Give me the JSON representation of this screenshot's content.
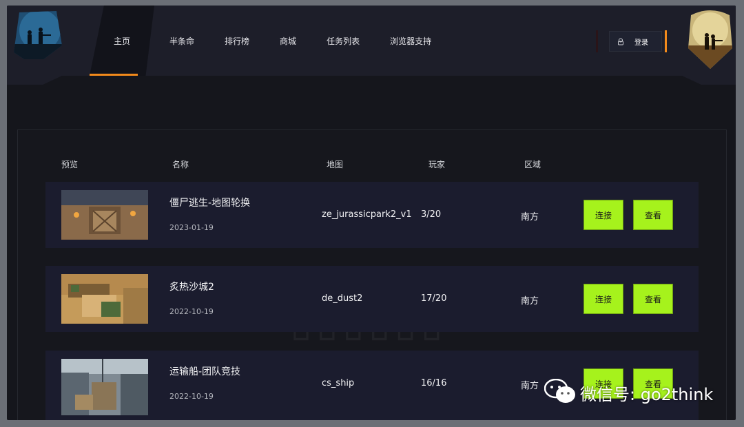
{
  "nav": {
    "items": [
      {
        "label": "主页",
        "active": true
      },
      {
        "label": "半条命",
        "active": false
      },
      {
        "label": "排行榜",
        "active": false
      },
      {
        "label": "商城",
        "active": false
      },
      {
        "label": "任务列表",
        "active": false
      },
      {
        "label": "浏览器支持",
        "active": false
      }
    ],
    "login_label": "登录",
    "login_icon": "user-icon"
  },
  "colors": {
    "accent_orange": "#f28a1b",
    "button_green": "#a6f21c",
    "row_bg": "#1b1c2e",
    "page_bg": "#15161c"
  },
  "table": {
    "headers": {
      "preview": "预览",
      "name": "名称",
      "map": "地图",
      "players": "玩家",
      "region": "区域"
    },
    "rows": [
      {
        "name": "僵尸逃生-地图轮换",
        "date": "2023-01-19",
        "map": "ze_jurassicpark2_v1",
        "players": "3/20",
        "region": "南方",
        "connect": "连接",
        "view": "查看"
      },
      {
        "name": "炙热沙城2",
        "date": "2022-10-19",
        "map": "de_dust2",
        "players": "17/20",
        "region": "南方",
        "connect": "连接",
        "view": "查看"
      },
      {
        "name": "运输船-团队竞技",
        "date": "2022-10-19",
        "map": "cs_ship",
        "players": "16/16",
        "region": "南方",
        "connect": "连接",
        "view": "查看"
      }
    ]
  },
  "overlay": {
    "watermark_text": "微信号: go2think"
  }
}
